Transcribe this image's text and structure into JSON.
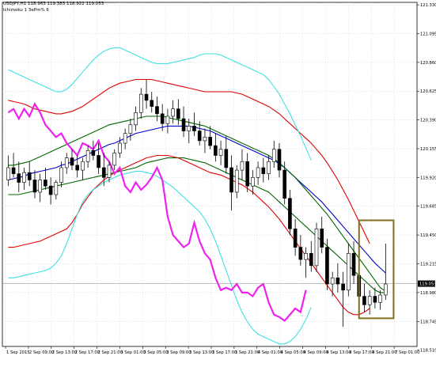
{
  "header": {
    "symbol_line": "USDJPY,H1  118.963 119.383 118.922 119.053",
    "indicator_line": "Ichimoku 1 3ePm% 6"
  },
  "colors": {
    "background": "#ffffff",
    "grid": "#c8c8c8",
    "candle_up_body": "#ffffff",
    "candle_down_body": "#000000",
    "candle_outline": "#000000",
    "ma_blue": "#0000cc",
    "ma_green": "#006400",
    "band_red": "#e00000",
    "band_cyan": "#40e0e0",
    "chikou_magenta": "#ee22ee",
    "highlight_box": "#807020",
    "current_price_line": "#808080"
  },
  "chart_data": {
    "type": "candlestick",
    "title": "",
    "symbol": "USDJPY",
    "timeframe": "H1",
    "ohlc_header": {
      "open": 118.963,
      "high": 119.383,
      "low": 118.922,
      "close": 119.053
    },
    "current_price_label": "119.053",
    "y_axis": {
      "range": [
        118.54,
        121.35
      ],
      "tick_labels": [
        "121.330",
        "121.095",
        "120.860",
        "120.625",
        "120.390",
        "120.155",
        "119.920",
        "119.685",
        "119.450",
        "119.215",
        "118.980",
        "118.745",
        "118.510"
      ]
    },
    "x_axis": {
      "tick_labels": [
        "1 Sep 2015",
        "2 Sep 09:00",
        "2 Sep 13:00",
        "2 Sep 17:00",
        "2 Sep 21:00",
        "3 Sep 01:00",
        "3 Sep 05:00",
        "3 Sep 09:00",
        "3 Sep 13:00",
        "3 Sep 17:00",
        "3 Sep 21:00",
        "4 Sep 01:00",
        "4 Sep 05:00",
        "4 Sep 09:00",
        "4 Sep 13:00",
        "4 Sep 17:00",
        "4 Sep 21:00",
        "7 Sep 01:00"
      ]
    },
    "candles": [
      [
        119.9,
        120.1,
        119.85,
        120.0
      ],
      [
        120.0,
        120.12,
        119.92,
        119.95
      ],
      [
        119.95,
        120.05,
        119.8,
        119.88
      ],
      [
        119.88,
        120.0,
        119.82,
        119.96
      ],
      [
        119.96,
        120.05,
        119.85,
        119.9
      ],
      [
        119.9,
        119.98,
        119.75,
        119.8
      ],
      [
        119.8,
        119.95,
        119.72,
        119.9
      ],
      [
        119.9,
        120.0,
        119.82,
        119.85
      ],
      [
        119.85,
        119.92,
        119.7,
        119.78
      ],
      [
        119.78,
        119.9,
        119.74,
        119.88
      ],
      [
        119.88,
        120.05,
        119.84,
        120.0
      ],
      [
        120.0,
        120.12,
        119.95,
        120.08
      ],
      [
        120.08,
        120.15,
        119.98,
        120.02
      ],
      [
        120.02,
        120.1,
        119.92,
        119.98
      ],
      [
        119.98,
        120.08,
        119.9,
        120.05
      ],
      [
        120.05,
        120.18,
        120.0,
        120.14
      ],
      [
        120.14,
        120.22,
        120.06,
        120.1
      ],
      [
        120.1,
        120.2,
        119.95,
        120.0
      ],
      [
        120.0,
        120.12,
        119.85,
        119.92
      ],
      [
        119.92,
        120.05,
        119.88,
        120.02
      ],
      [
        120.02,
        120.15,
        119.98,
        120.12
      ],
      [
        120.12,
        120.25,
        120.08,
        120.2
      ],
      [
        120.2,
        120.32,
        120.15,
        120.28
      ],
      [
        120.28,
        120.4,
        120.22,
        120.35
      ],
      [
        120.35,
        120.5,
        120.3,
        120.45
      ],
      [
        120.45,
        120.65,
        120.4,
        120.6
      ],
      [
        120.6,
        120.72,
        120.48,
        120.55
      ],
      [
        120.55,
        120.62,
        120.45,
        120.5
      ],
      [
        120.5,
        120.58,
        120.38,
        120.44
      ],
      [
        120.44,
        120.52,
        120.3,
        120.36
      ],
      [
        120.36,
        120.48,
        120.28,
        120.42
      ],
      [
        120.42,
        120.55,
        120.36,
        120.48
      ],
      [
        120.48,
        120.56,
        120.35,
        120.4
      ],
      [
        120.4,
        120.5,
        120.25,
        120.3
      ],
      [
        120.3,
        120.4,
        120.2,
        120.34
      ],
      [
        120.34,
        120.45,
        120.26,
        120.3
      ],
      [
        120.3,
        120.38,
        120.18,
        120.22
      ],
      [
        120.22,
        120.32,
        120.12,
        120.25
      ],
      [
        120.25,
        120.34,
        120.15,
        120.18
      ],
      [
        120.18,
        120.28,
        120.05,
        120.1
      ],
      [
        120.1,
        120.22,
        120.02,
        120.15
      ],
      [
        120.15,
        120.26,
        119.95,
        120.0
      ],
      [
        120.0,
        120.1,
        119.65,
        119.8
      ],
      [
        119.8,
        120.02,
        119.75,
        119.98
      ],
      [
        119.98,
        120.15,
        119.9,
        120.05
      ],
      [
        120.05,
        120.12,
        119.8,
        119.85
      ],
      [
        119.85,
        119.98,
        119.78,
        119.92
      ],
      [
        119.92,
        120.05,
        119.86,
        120.0
      ],
      [
        120.0,
        120.08,
        119.88,
        119.95
      ],
      [
        119.95,
        120.1,
        119.9,
        120.05
      ],
      [
        120.05,
        120.22,
        120.0,
        120.15
      ],
      [
        120.15,
        120.2,
        119.92,
        119.98
      ],
      [
        119.98,
        120.05,
        119.7,
        119.75
      ],
      [
        119.75,
        119.82,
        119.45,
        119.5
      ],
      [
        119.5,
        119.58,
        119.28,
        119.35
      ],
      [
        119.35,
        119.45,
        119.2,
        119.25
      ],
      [
        119.25,
        119.35,
        119.1,
        119.3
      ],
      [
        119.3,
        119.4,
        119.15,
        119.2
      ],
      [
        119.2,
        119.55,
        119.15,
        119.5
      ],
      [
        119.5,
        119.6,
        119.3,
        119.35
      ],
      [
        119.35,
        119.42,
        119.0,
        119.05
      ],
      [
        119.05,
        119.15,
        118.95,
        119.1
      ],
      [
        119.1,
        119.22,
        118.98,
        119.05
      ],
      [
        119.05,
        119.15,
        118.7,
        119.0
      ],
      [
        119.0,
        119.38,
        118.95,
        119.3
      ],
      [
        119.3,
        119.4,
        119.05,
        119.12
      ],
      [
        119.12,
        119.2,
        118.9,
        118.95
      ],
      [
        118.95,
        119.05,
        118.82,
        118.88
      ],
      [
        118.88,
        119.0,
        118.8,
        118.95
      ],
      [
        118.95,
        119.02,
        118.85,
        118.9
      ],
      [
        118.9,
        119.0,
        118.84,
        118.96
      ],
      [
        118.96,
        119.38,
        118.92,
        119.05
      ]
    ],
    "series": [
      {
        "name": "",
        "color": "#0000cc",
        "values": [
          119.9,
          119.91,
          119.92,
          119.93,
          119.95,
          119.96,
          119.97,
          119.98,
          119.99,
          120.0,
          120.02,
          120.03,
          120.05,
          120.07,
          120.09,
          120.11,
          120.13,
          120.15,
          120.17,
          120.19,
          120.2,
          120.22,
          120.24,
          120.26,
          120.28,
          120.29,
          120.3,
          120.31,
          120.32,
          120.33,
          120.34,
          120.34,
          120.34,
          120.34,
          120.34,
          120.33,
          120.32,
          120.31,
          120.3,
          120.28,
          120.26,
          120.24,
          120.22,
          120.2,
          120.18,
          120.16,
          120.14,
          120.12,
          120.1,
          120.08,
          120.06,
          120.03,
          120.0,
          119.96,
          119.92,
          119.88,
          119.84,
          119.8,
          119.76,
          119.72,
          119.67,
          119.62,
          119.57,
          119.52,
          119.47,
          119.42,
          119.37,
          119.32,
          119.27,
          119.22,
          119.18,
          119.14
        ]
      },
      {
        "name": "",
        "color": "#006400",
        "values": [
          120.02,
          120.02,
          120.03,
          120.04,
          120.05,
          120.07,
          120.09,
          120.11,
          120.13,
          120.15,
          120.17,
          120.19,
          120.21,
          120.23,
          120.25,
          120.27,
          120.29,
          120.31,
          120.33,
          120.35,
          120.36,
          120.37,
          120.38,
          120.39,
          120.4,
          120.41,
          120.42,
          120.42,
          120.42,
          120.42,
          120.41,
          120.4,
          120.39,
          120.38,
          120.37,
          120.36,
          120.35,
          120.34,
          120.32,
          120.3,
          120.28,
          120.26,
          120.24,
          120.22,
          120.2,
          120.18,
          120.16,
          120.14,
          120.12,
          120.1,
          120.07,
          120.04,
          120.0,
          119.96,
          119.92,
          119.87,
          119.82,
          119.77,
          119.72,
          119.67,
          119.62,
          119.56,
          119.5,
          119.44,
          119.38,
          119.32,
          119.26,
          119.2,
          119.14,
          119.08,
          119.02,
          118.99
        ]
      },
      {
        "name": "",
        "color": "#006400",
        "values": [
          119.78,
          119.78,
          119.78,
          119.79,
          119.8,
          119.81,
          119.82,
          119.83,
          119.84,
          119.85,
          119.86,
          119.87,
          119.88,
          119.89,
          119.9,
          119.91,
          119.92,
          119.93,
          119.94,
          119.95,
          119.96,
          119.97,
          119.98,
          119.99,
          120.0,
          120.02,
          120.04,
          120.05,
          120.06,
          120.07,
          120.08,
          120.08,
          120.08,
          120.08,
          120.07,
          120.06,
          120.05,
          120.04,
          120.02,
          120.0,
          119.98,
          119.96,
          119.94,
          119.92,
          119.9,
          119.88,
          119.86,
          119.84,
          119.82,
          119.8,
          119.76,
          119.72,
          119.68,
          119.64,
          119.6,
          119.56,
          119.52,
          119.48,
          119.44,
          119.4,
          119.36,
          119.32,
          119.28,
          119.24,
          119.2,
          119.16,
          119.12,
          119.08,
          119.04,
          119.0,
          118.98,
          118.98
        ]
      },
      {
        "name": "",
        "color": "#e00000",
        "values": [
          120.55,
          120.54,
          120.53,
          120.52,
          120.5,
          120.48,
          120.47,
          120.46,
          120.45,
          120.44,
          120.44,
          120.45,
          120.46,
          120.48,
          120.5,
          120.53,
          120.56,
          120.59,
          120.62,
          120.65,
          120.67,
          120.69,
          120.7,
          120.71,
          120.72,
          120.72,
          120.72,
          120.72,
          120.71,
          120.7,
          120.69,
          120.68,
          120.67,
          120.66,
          120.65,
          120.64,
          120.63,
          120.62,
          120.62,
          120.62,
          120.62,
          120.62,
          120.62,
          120.61,
          120.6,
          120.58,
          120.56,
          120.54,
          120.52,
          120.5,
          120.47,
          120.44,
          120.4,
          120.36,
          120.32,
          120.28,
          120.24,
          120.2,
          120.15,
          120.1,
          120.04,
          119.97,
          119.9,
          119.82,
          119.74,
          119.65,
          119.56,
          119.47,
          119.38
        ]
      },
      {
        "name": "",
        "color": "#e00000",
        "values": [
          119.35,
          119.35,
          119.36,
          119.37,
          119.38,
          119.39,
          119.4,
          119.42,
          119.44,
          119.46,
          119.48,
          119.5,
          119.55,
          119.62,
          119.7,
          119.76,
          119.82,
          119.86,
          119.9,
          119.93,
          119.96,
          119.98,
          120.0,
          120.02,
          120.04,
          120.06,
          120.08,
          120.09,
          120.1,
          120.1,
          120.1,
          120.09,
          120.08,
          120.06,
          120.04,
          120.02,
          120.0,
          119.98,
          119.96,
          119.95,
          119.94,
          119.92,
          119.9,
          119.88,
          119.86,
          119.83,
          119.8,
          119.76,
          119.72,
          119.68,
          119.63,
          119.58,
          119.52,
          119.46,
          119.4,
          119.34,
          119.28,
          119.22,
          119.16,
          119.1,
          119.04,
          118.98,
          118.92,
          118.86,
          118.82,
          118.8,
          118.8,
          118.82,
          118.85
        ]
      },
      {
        "name": "",
        "color": "#40e0e0",
        "values": [
          120.8,
          120.78,
          120.76,
          120.74,
          120.72,
          120.7,
          120.68,
          120.66,
          120.64,
          120.62,
          120.62,
          120.64,
          120.68,
          120.73,
          120.78,
          120.83,
          120.88,
          120.92,
          120.95,
          120.97,
          120.98,
          120.98,
          120.96,
          120.94,
          120.92,
          120.9,
          120.88,
          120.86,
          120.85,
          120.85,
          120.85,
          120.86,
          120.87,
          120.88,
          120.89,
          120.9,
          120.92,
          120.93,
          120.93,
          120.93,
          120.92,
          120.9,
          120.88,
          120.86,
          120.84,
          120.82,
          120.8,
          120.78,
          120.76,
          120.72,
          120.66,
          120.6,
          120.52,
          120.44,
          120.35,
          120.26,
          120.16,
          120.06
        ]
      },
      {
        "name": "",
        "color": "#40e0e0",
        "values": [
          119.1,
          119.1,
          119.11,
          119.12,
          119.13,
          119.14,
          119.15,
          119.16,
          119.18,
          119.22,
          119.28,
          119.38,
          119.5,
          119.62,
          119.72,
          119.78,
          119.82,
          119.85,
          119.88,
          119.9,
          119.92,
          119.94,
          119.95,
          119.96,
          119.97,
          119.97,
          119.96,
          119.95,
          119.93,
          119.9,
          119.87,
          119.84,
          119.8,
          119.76,
          119.72,
          119.68,
          119.64,
          119.58,
          119.5,
          119.4,
          119.28,
          119.16,
          119.04,
          118.92,
          118.82,
          118.74,
          118.68,
          118.64,
          118.62,
          118.6,
          118.58,
          118.56,
          118.56,
          118.58,
          118.62,
          118.68,
          118.76,
          118.86
        ]
      },
      {
        "name": "",
        "color": "#ee22ee",
        "values": [
          120.45,
          120.48,
          120.4,
          120.48,
          120.42,
          120.52,
          120.45,
          120.35,
          120.3,
          120.25,
          120.28,
          120.2,
          120.15,
          120.1,
          120.2,
          120.18,
          120.15,
          120.22,
          120.1,
          120.05,
          119.95,
          120.0,
          119.85,
          119.8,
          119.88,
          119.82,
          119.86,
          119.92,
          120.0,
          119.9,
          119.6,
          119.45,
          119.4,
          119.35,
          119.38,
          119.55,
          119.4,
          119.3,
          119.25,
          119.1,
          119.0,
          119.02,
          119.0,
          119.05,
          118.98,
          118.98,
          118.95,
          119.02,
          119.05,
          118.9,
          118.8,
          118.78,
          118.75,
          118.8,
          118.85,
          118.82,
          119.0
        ]
      }
    ],
    "series_start": [
      0,
      0,
      0,
      0,
      0,
      0,
      0,
      0
    ],
    "highlight_boxes": [
      {
        "x0": 66.0,
        "x1": 72.5,
        "y_top": 119.57,
        "y_bottom": 118.77
      },
      {
        "x0": 90.0,
        "x1": 95.5,
        "y_top": 119.7,
        "y_bottom": 118.66
      }
    ],
    "grid": true,
    "legend": "none"
  }
}
